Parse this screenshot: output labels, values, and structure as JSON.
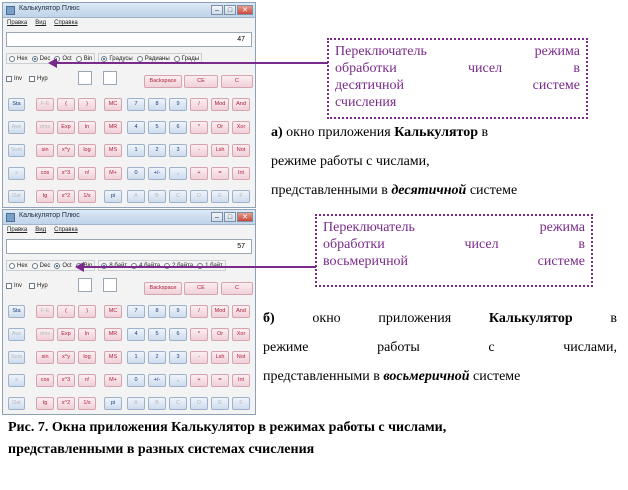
{
  "calculator_top": {
    "title": "Калькулятор Плюс",
    "menu": [
      "Правка",
      "Вид",
      "Справка"
    ],
    "display_value": "47",
    "base_options": [
      "Hex",
      "Dec",
      "Oct",
      "Bin"
    ],
    "selected_base": "Dec",
    "unit_options": [
      "Градусы",
      "Радианы",
      "Грады"
    ],
    "selected_unit": "Градусы",
    "checkboxes": [
      "Inv",
      "Hyp"
    ],
    "keys": {
      "row1": [
        "Backspace",
        "CE",
        "C"
      ],
      "row2": [
        "Sta",
        "F-E",
        "(",
        ")",
        "MC",
        "7",
        "8",
        "9",
        "/",
        "Mod",
        "And"
      ],
      "row3": [
        "Ave",
        "dms",
        "Exp",
        "ln",
        "MR",
        "4",
        "5",
        "6",
        "*",
        "Or",
        "Xor"
      ],
      "row4": [
        "Sum",
        "sin",
        "x^y",
        "log",
        "MS",
        "1",
        "2",
        "3",
        "-",
        "Lsh",
        "Not"
      ],
      "row5": [
        "s",
        "cos",
        "x^3",
        "n!",
        "M+",
        "0",
        "+/-",
        ",",
        "+",
        "=",
        "Int"
      ],
      "row6": [
        "Dat",
        "tg",
        "x^2",
        "1/x",
        "pi",
        "A",
        "B",
        "C",
        "D",
        "E",
        "F"
      ]
    }
  },
  "calculator_bottom": {
    "title": "Калькулятор Плюс",
    "menu": [
      "Правка",
      "Вид",
      "Справка"
    ],
    "display_value": "57",
    "base_options": [
      "Hex",
      "Dec",
      "Oct",
      "Bin"
    ],
    "selected_base": "Oct",
    "unit_options": [
      "8 байт",
      "4 байта",
      "2 байта",
      "1 байт"
    ],
    "selected_unit": "8 байт",
    "checkboxes": [
      "Inv",
      "Hyp"
    ],
    "keys": {
      "row1": [
        "Backspace",
        "CE",
        "C"
      ],
      "row2": [
        "Sta",
        "F-E",
        "(",
        ")",
        "MC",
        "7",
        "8",
        "9",
        "/",
        "Mod",
        "And"
      ],
      "row3": [
        "Ave",
        "dms",
        "Exp",
        "ln",
        "MR",
        "4",
        "5",
        "6",
        "*",
        "Or",
        "Xor"
      ],
      "row4": [
        "Sum",
        "sin",
        "x^y",
        "log",
        "MS",
        "1",
        "2",
        "3",
        "-",
        "Lsh",
        "Not"
      ],
      "row5": [
        "s",
        "cos",
        "x^3",
        "n!",
        "M+",
        "0",
        "+/-",
        ",",
        "+",
        "=",
        "Int"
      ],
      "row6": [
        "Dat",
        "tg",
        "x^2",
        "1/x",
        "pi",
        "A",
        "B",
        "C",
        "D",
        "E",
        "F"
      ]
    }
  },
  "callout_top": {
    "line1": "Переключатель режима",
    "line2": "обработки чисел в",
    "line3": "десятичной системе",
    "line4": "счисления"
  },
  "callout_bottom": {
    "line1": "Переключатель режима",
    "line2": "обработки чисел в",
    "line3": "восьмеричной системе"
  },
  "caption_a": {
    "label": "а)",
    "text1": " окно приложения ",
    "app": "Калькулятор",
    "text2": " в",
    "line2": "режиме работы с числами,",
    "line3_pre": "представленными в ",
    "line3_em": "десятичной",
    "line3_post": " системе"
  },
  "caption_b": {
    "label": "б)",
    "w1": "окно",
    "w2": "приложения",
    "app": "Калькулятор",
    "w3": "в",
    "line2_w1": "режиме",
    "line2_w2": "работы",
    "line2_w3": "с",
    "line2_w4": "числами,",
    "line3_pre": "представленными в ",
    "line3_em": "восьмеричной",
    "line3_post": " системе"
  },
  "figure_caption": {
    "prefix": "Рис. 7. Окна приложения ",
    "app": "Калькулятор",
    "rest": " в режимах работы с числами,",
    "line2": "представленными в разных системах счисления"
  }
}
